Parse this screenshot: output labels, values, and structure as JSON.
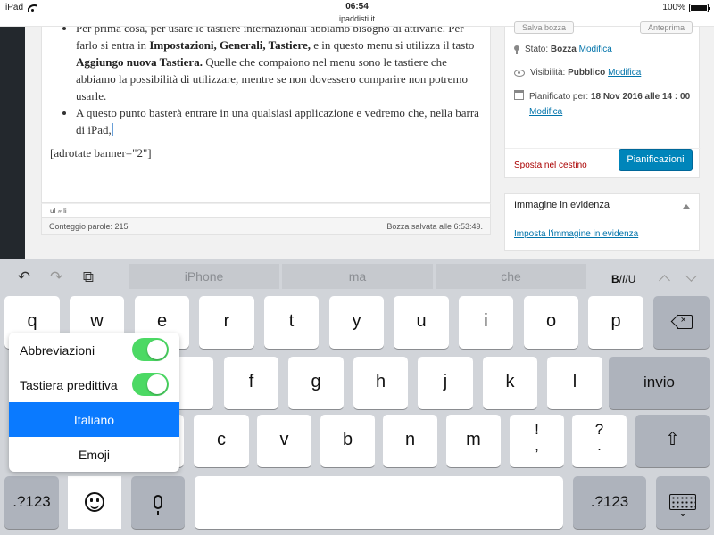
{
  "status_bar": {
    "device": "iPad",
    "time": "06:54",
    "url": "ipaddisti.it",
    "battery": "100%",
    "battery_level": 1.0
  },
  "editor": {
    "bullet1_line1": "Per prima cosa, per usare le tastiere internazionali abbiamo bisogno di attivarle.",
    "bullet1_a": "Per farlo si entra in ",
    "bullet1_bold1": "Impostazioni, Generali, Tastiere,",
    "bullet1_b": " e in questo menu si utilizza il tasto ",
    "bullet1_bold2": "Aggiungo nuova Tastiera.",
    "bullet1_c": " Quelle che compaiono nel menu sono le tastiere che abbiamo la possibilità di utilizzare, mentre se non dovessero comparire non potremo usarle.",
    "bullet2": "A questo punto basterà entrare in una qualsiasi applicazione e vedremo che, nella barra di iPad,",
    "shortcode": "[adrotate banner=\"2\"]",
    "path": "ul » li",
    "word_count": "Conteggio parole: 215",
    "draft_saved": "Bozza salvata alle 6:53:49."
  },
  "publish": {
    "save_draft": "Salva bozza",
    "preview": "Anteprima",
    "status_label": "Stato:",
    "status_value": "Bozza",
    "visibility_label": "Visibilità:",
    "visibility_value": "Pubblico",
    "scheduled_label": "Pianificato per:",
    "scheduled_value": "18 Nov 2016 alle 14 : 00",
    "edit": "Modifica",
    "trash": "Sposta nel cestino",
    "schedule_button": "Pianificazioni"
  },
  "featured": {
    "title": "Immagine in evidenza",
    "link": "Imposta l'immagine in evidenza"
  },
  "keyboard": {
    "suggestions": [
      "iPhone",
      "ma",
      "che"
    ],
    "format_b": "B",
    "format_i": "I",
    "format_u": "U",
    "row1": [
      "q",
      "w",
      "e",
      "r",
      "t",
      "y",
      "u",
      "i",
      "o",
      "p"
    ],
    "row2": [
      "d",
      "f",
      "g",
      "h",
      "j",
      "k",
      "l"
    ],
    "row3": [
      "c",
      "v",
      "b",
      "n",
      "m"
    ],
    "enter": "invio",
    "numbers": ".?123",
    "excl_top": "!",
    "excl_bottom": ",",
    "quest_top": "?",
    "quest_bottom": ".",
    "shift_glyph": "⇧",
    "undo_glyph": "↶",
    "redo_glyph": "↷",
    "paste_glyph": "⧉",
    "hide_chev": "⌄"
  },
  "popup": {
    "abbreviations": "Abbreviazioni",
    "abbreviations_on": true,
    "predictive": "Tastiera predittiva",
    "predictive_on": true,
    "lang_selected": "Italiano",
    "lang_other": "Emoji"
  },
  "colors": {
    "accent": "#0085ba",
    "link": "#0073aa",
    "toggle": "#4cd964",
    "selected": "#0a7aff",
    "trash": "#aa0000"
  }
}
